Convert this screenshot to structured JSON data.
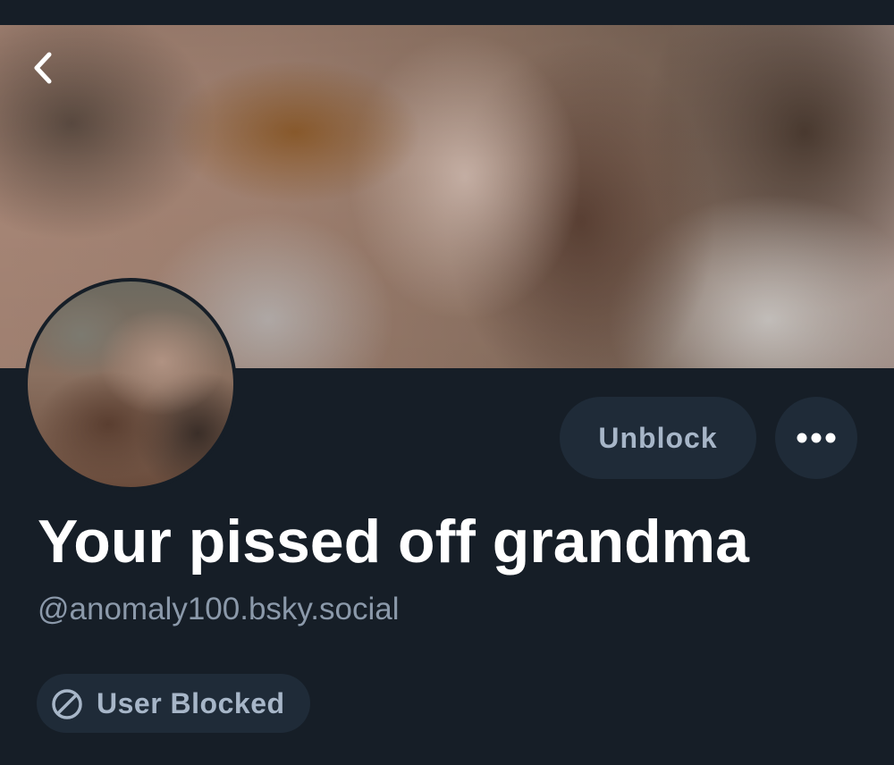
{
  "profile": {
    "display_name": "Your pissed off grandma",
    "handle": "@anomaly100.bsky.social",
    "banner_icon": "blurred-banner-image",
    "avatar_icon": "blurred-avatar-image"
  },
  "nav": {
    "back_icon": "chevron-left-icon"
  },
  "actions": {
    "unblock_label": "Unblock",
    "more_icon": "ellipsis-icon"
  },
  "status": {
    "blocked_label": "User Blocked",
    "blocked_icon": "ban-icon"
  },
  "colors": {
    "background": "#161e27",
    "button_bg": "#1f2b38",
    "button_text": "#a7b6c8",
    "handle_text": "#8b99aa",
    "name_text": "#ffffff"
  }
}
